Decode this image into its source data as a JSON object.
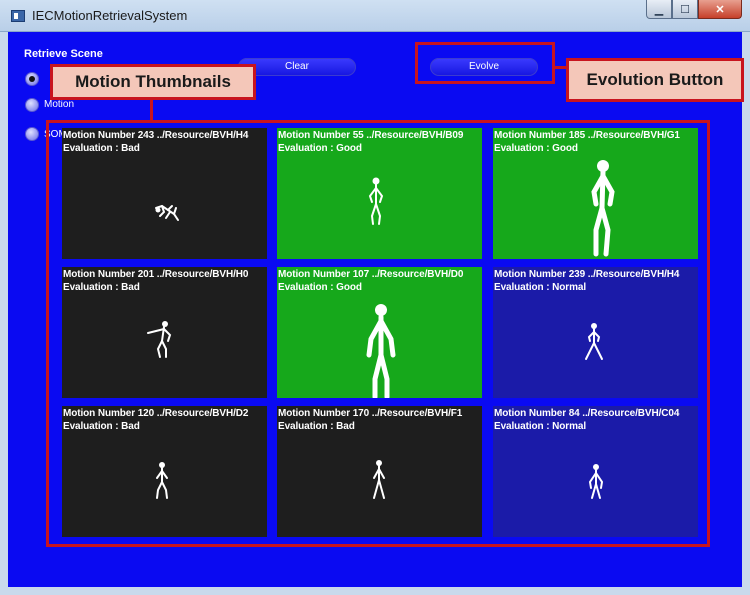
{
  "window": {
    "title": "IECMotionRetrievalSystem",
    "minimize_glyph": "▁",
    "maximize_glyph": "☐",
    "close_glyph": "✕"
  },
  "left_panel": {
    "group_label": "Retrieve Scene",
    "radio_options": [
      {
        "label": "",
        "checked": true
      },
      {
        "label": "Motion",
        "checked": false
      },
      {
        "label": "SOM",
        "checked": false
      }
    ]
  },
  "buttons": {
    "clear": "Clear",
    "evolve": "Evolve"
  },
  "annotations": {
    "motion_thumbnails": "Motion Thumbnails",
    "evolution_button": "Evolution Button"
  },
  "thumbnails": [
    {
      "line1": "Motion Number 243 ../Resource/BVH/H4",
      "line2": "Evaluation : Bad",
      "bg": "#1e1e1e"
    },
    {
      "line1": "Motion Number 55 ../Resource/BVH/B09",
      "line2": "Evaluation : Good",
      "bg": "#16a81b"
    },
    {
      "line1": "Motion Number 185 ../Resource/BVH/G1",
      "line2": "Evaluation : Good",
      "bg": "#16a81b"
    },
    {
      "line1": "Motion Number 201 ../Resource/BVH/H0",
      "line2": "Evaluation : Bad",
      "bg": "#1e1e1e"
    },
    {
      "line1": "Motion Number 107 ../Resource/BVH/D0",
      "line2": "Evaluation : Good",
      "bg": "#16a81b"
    },
    {
      "line1": "Motion Number 239 ../Resource/BVH/H4",
      "line2": "Evaluation : Normal",
      "bg": "#1b1ba8"
    },
    {
      "line1": "Motion Number 120 ../Resource/BVH/D2",
      "line2": "Evaluation : Bad",
      "bg": "#1e1e1e"
    },
    {
      "line1": "Motion Number 170 ../Resource/BVH/F1",
      "line2": "Evaluation : Bad",
      "bg": "#1e1e1e"
    },
    {
      "line1": "Motion Number 84 ../Resource/BVH/C04",
      "line2": "Evaluation : Normal",
      "bg": "#1b1ba8"
    }
  ],
  "colors": {
    "client_bg": "#0a0af2",
    "highlight": "#c8141e",
    "callout_bg": "#f4c7b9"
  }
}
